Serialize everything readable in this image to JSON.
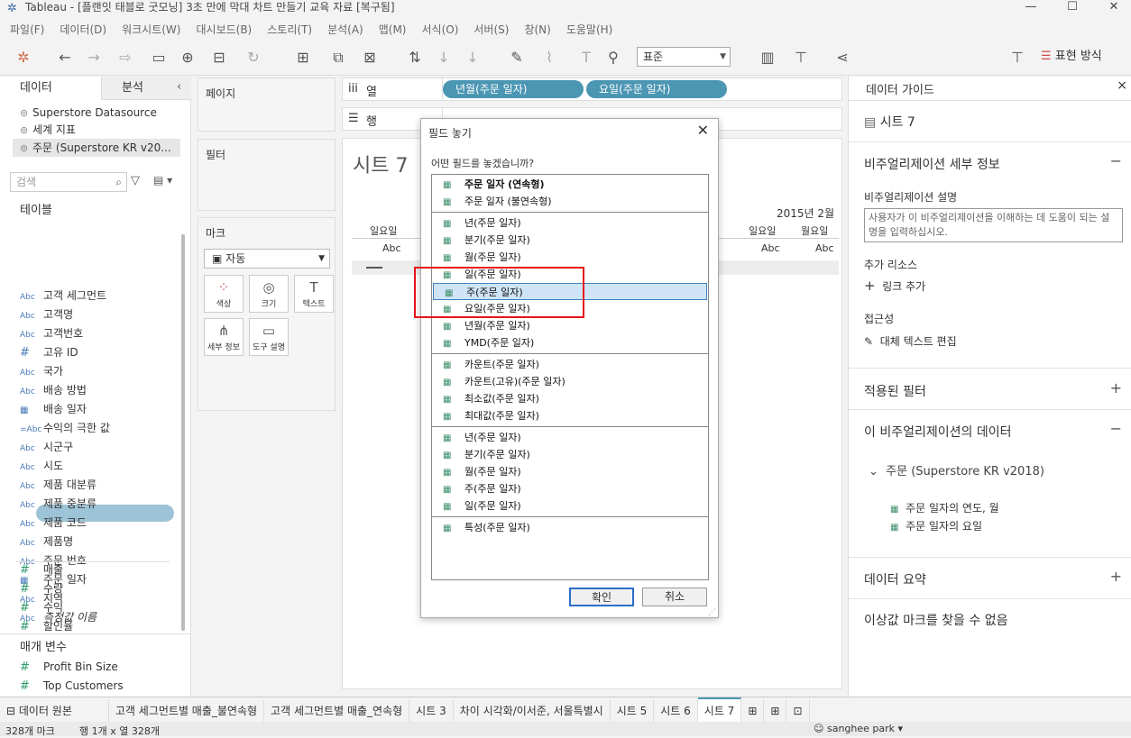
{
  "window": {
    "title": "Tableau - [플랜잇 태블로 굿모닝] 3초 만에 막대 차트 만들기 교육 자료 [복구됨]",
    "minimize": "—",
    "maximize": "☐",
    "close": "✕"
  },
  "menu": [
    "파일(F)",
    "데이터(D)",
    "워크시트(W)",
    "대시보드(B)",
    "스토리(T)",
    "분석(A)",
    "맵(M)",
    "서식(O)",
    "서버(S)",
    "창(N)",
    "도움말(H)"
  ],
  "toolbar": {
    "fit_value": "표준",
    "show_me_label": "표현 방식"
  },
  "datapane": {
    "tab_data": "데이터",
    "tab_analysis": "분석",
    "datasources": [
      "Superstore Datasource",
      "세계 지표",
      "주문 (Superstore KR v20..."
    ],
    "search_placeholder": "검색",
    "tables_header": "테이블",
    "fields": [
      {
        "type": "Abc",
        "name": "고객 세그먼트"
      },
      {
        "type": "Abc",
        "name": "고객명"
      },
      {
        "type": "Abc",
        "name": "고객번호"
      },
      {
        "type": "#",
        "name": "고유 ID"
      },
      {
        "type": "Abc",
        "name": "국가"
      },
      {
        "type": "Abc",
        "name": "배송 방법"
      },
      {
        "type": "cal",
        "name": "배송 일자"
      },
      {
        "type": "=Abc",
        "name": "수익의 극한 값"
      },
      {
        "type": "Abc",
        "name": "시군구"
      },
      {
        "type": "Abc",
        "name": "시도"
      },
      {
        "type": "Abc",
        "name": "제품 대분류"
      },
      {
        "type": "Abc",
        "name": "제품 중분류"
      },
      {
        "type": "Abc",
        "name": "제품 코드"
      },
      {
        "type": "Abc",
        "name": "제품명"
      },
      {
        "type": "Abc",
        "name": "주문 번호"
      },
      {
        "type": "cal",
        "name": "주문 일자"
      },
      {
        "type": "Abc",
        "name": "지역"
      },
      {
        "type": "Abc",
        "name": "측정값 이름"
      }
    ],
    "measures": [
      "매출",
      "수량",
      "수익",
      "할인율"
    ],
    "params_header": "매개 변수",
    "params": [
      "Profit Bin Size",
      "Top Customers"
    ]
  },
  "cards": {
    "pages": "페이지",
    "filters": "필터",
    "marks": "마크",
    "mark_type": "자동",
    "mark_buttons": [
      "색상",
      "크기",
      "텍스트",
      "세부 정보",
      "도구 설명"
    ]
  },
  "shelves": {
    "columns_label": "열",
    "rows_label": "행",
    "column_pills": [
      "년월(주문 일자)",
      "요일(주문 일자)"
    ]
  },
  "viz": {
    "sheet_title": "시트 7",
    "year_header": "2015년 2월",
    "day_headers": [
      "일요일",
      "일요일",
      "월요일"
    ],
    "abc_cells": [
      "Abc",
      "Abc",
      "Abc"
    ]
  },
  "dialog": {
    "title": "필드 놓기",
    "question": "어떤 필드를 놓겠습니까?",
    "groups": [
      [
        "주문 일자 (연속형)",
        "주문 일자 (불연속형)"
      ],
      [
        "년(주문 일자)",
        "분기(주문 일자)",
        "월(주문 일자)",
        "일(주문 일자)",
        "주(주문 일자)",
        "요일(주문 일자)",
        "년월(주문 일자)",
        "YMD(주문 일자)"
      ],
      [
        "카운트(주문 일자)",
        "카운트(고유)(주문 일자)",
        "최소값(주문 일자)",
        "최대값(주문 일자)"
      ],
      [
        "년(주문 일자)",
        "분기(주문 일자)",
        "월(주문 일자)",
        "주(주문 일자)",
        "일(주문 일자)"
      ],
      [
        "특성(주문 일자)"
      ]
    ],
    "ok_label": "확인",
    "cancel_label": "취소",
    "selected_item": "주(주문 일자)",
    "highlight_color": "#e8111a"
  },
  "guide": {
    "title": "데이터 가이드",
    "sheet": "시트 7",
    "viz_details": "비주얼리제이션 세부 정보",
    "desc_label": "비주얼리제이션 설명",
    "desc_placeholder": "사용자가 이 비주얼리제이션을 이해하는 데 도움이 되는 설명을 입력하십시오.",
    "more_resources": "추가 리소스",
    "add_link": "링크 추가",
    "accessibility": "접근성",
    "alt_text": "대체 텍스트 편집",
    "applied_filters": "적용된 필터",
    "viz_data": "이 비주얼리제이션의 데이터",
    "datasource": "주문 (Superstore KR v2018)",
    "data_fields": [
      "주문 일자의 연도, 월",
      "주문 일자의 요일"
    ],
    "data_summary": "데이터 요약",
    "outliers": "이상값 마크를 찾을 수 없음"
  },
  "tabs": [
    "데이터 원본",
    "고객 세그먼트별 매출_불연속형",
    "고객 세그먼트별 매출_연속형",
    "시트 3",
    "차이 시각화/이서준, 서울특별시",
    "시트 5",
    "시트 6",
    "시트 7"
  ],
  "status": {
    "marks": "328개 마크",
    "dims": "행 1개 x 열 328개",
    "user": "sanghee park"
  }
}
